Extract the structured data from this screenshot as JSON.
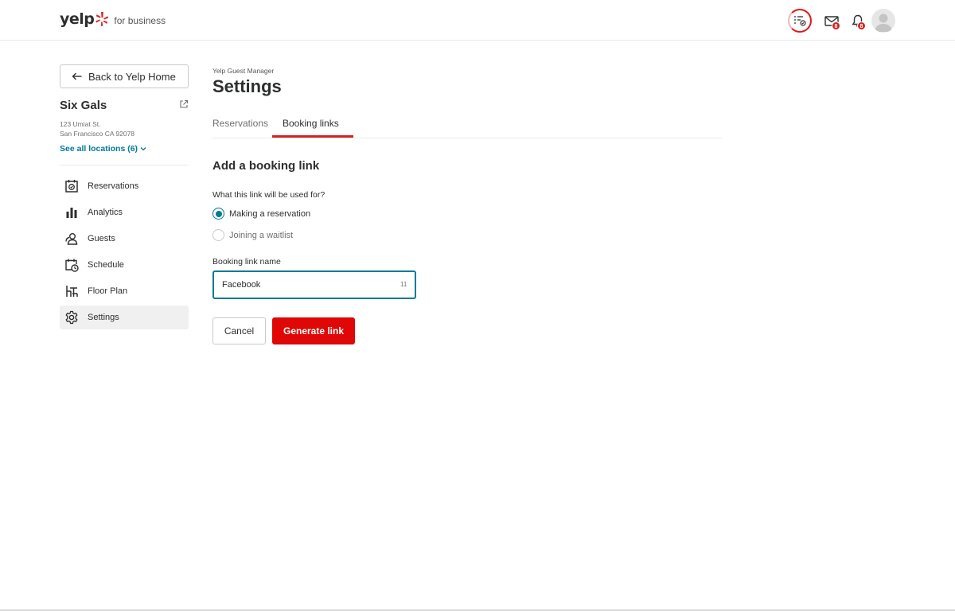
{
  "brand": {
    "wordmark": "yelp",
    "subtitle": "for business",
    "accent": "#d32323"
  },
  "header": {
    "icons": [
      "guest-manager-icon",
      "mail-icon",
      "bell-icon",
      "avatar"
    ],
    "mail_badge": "8",
    "notification_badge": "8"
  },
  "sidebar": {
    "back_label": "Back to Yelp Home",
    "business_name": "Six Gals",
    "address_line1": "123 Umiat St.",
    "address_line2": "San Francisco CA 92078",
    "see_all_label": "See all locations (6)",
    "items": [
      {
        "label": "Reservations",
        "icon": "calendar-check-icon"
      },
      {
        "label": "Analytics",
        "icon": "bar-chart-icon"
      },
      {
        "label": "Guests",
        "icon": "guests-icon"
      },
      {
        "label": "Schedule",
        "icon": "schedule-icon"
      },
      {
        "label": "Floor Plan",
        "icon": "floor-plan-icon"
      },
      {
        "label": "Settings",
        "icon": "gear-icon",
        "active": true
      }
    ]
  },
  "main": {
    "eyebrow": "Yelp Guest Manager",
    "title": "Settings",
    "tabs": [
      {
        "label": "Reservations",
        "active": false
      },
      {
        "label": "Booking links",
        "active": true
      }
    ],
    "form": {
      "heading": "Add a booking link",
      "question": "What this link will be used for?",
      "options": [
        {
          "label": "Making a reservation",
          "checked": true
        },
        {
          "label": "Joining a waitlist",
          "checked": false
        }
      ],
      "name_label": "Booking link name",
      "name_value": "Facebook",
      "char_count": "11",
      "cancel_label": "Cancel",
      "submit_label": "Generate link"
    }
  },
  "colors": {
    "link_teal": "#027a97",
    "primary_red": "#e00707",
    "text": "#2d2e2f"
  }
}
